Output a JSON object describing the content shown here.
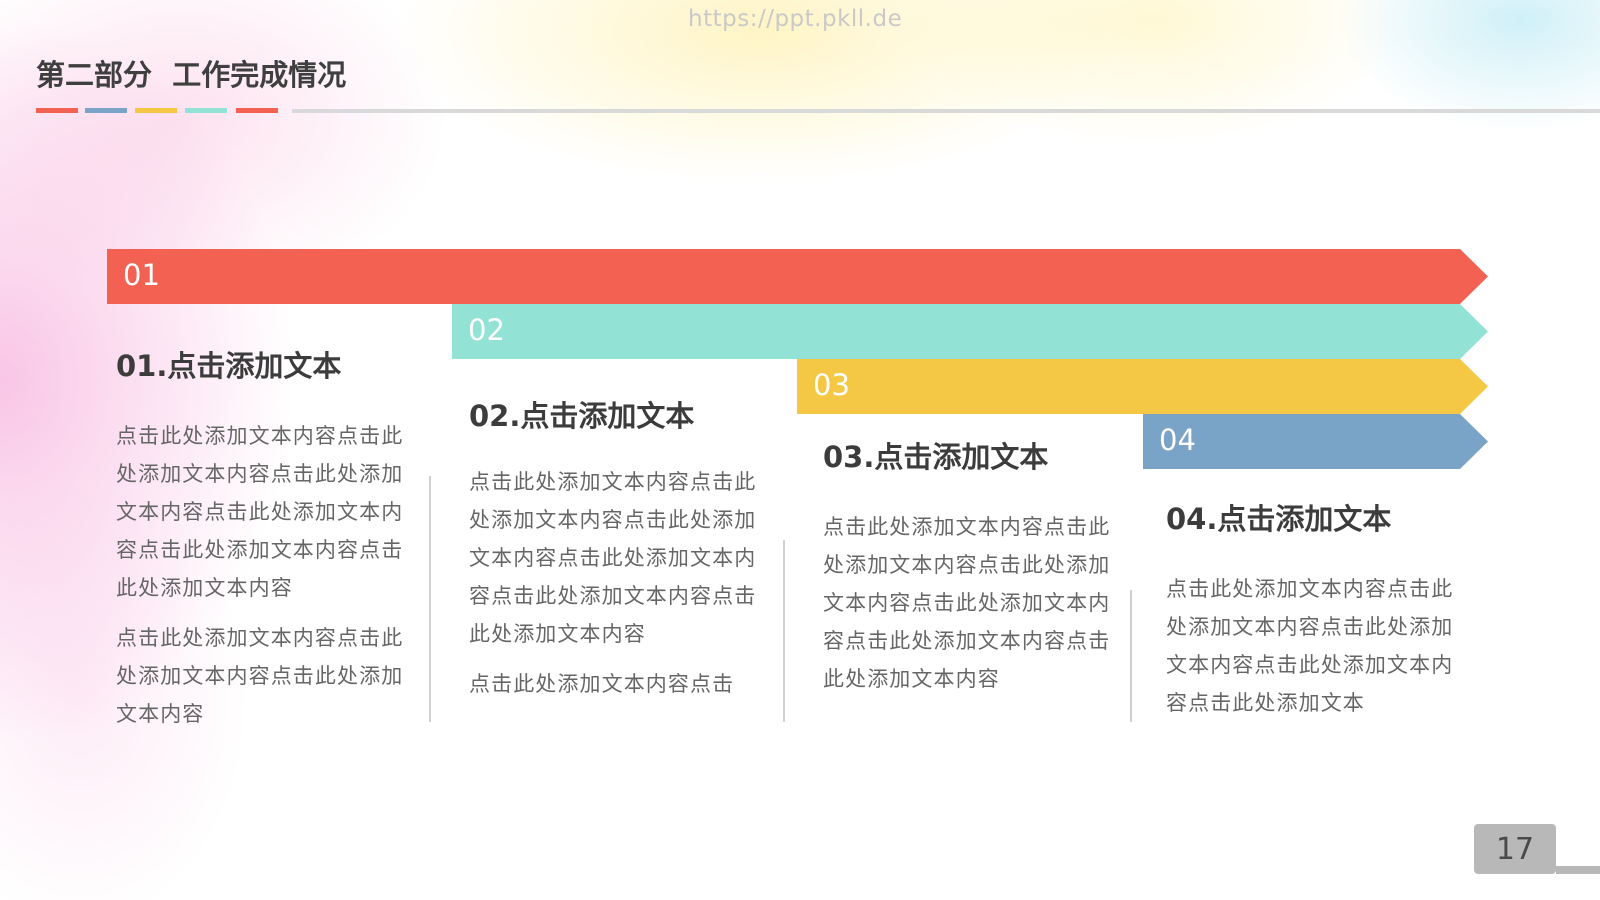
{
  "watermark": "https://ppt.pkll.de",
  "slide_title": "第二部分  工作完成情况",
  "colors": {
    "red": "#f26152",
    "teal": "#92e2d6",
    "yellow": "#f4c845",
    "blue": "#7aa3c8",
    "rule_gray": "#d9d9d9"
  },
  "title_rule_segments": [
    "#f26152",
    "#7aa3c8",
    "#f4c845",
    "#92e2d6",
    "#f26152"
  ],
  "arrows": [
    {
      "num": "01",
      "color": "#f26152"
    },
    {
      "num": "02",
      "color": "#92e2d6"
    },
    {
      "num": "03",
      "color": "#f4c845"
    },
    {
      "num": "04",
      "color": "#7aa3c8"
    }
  ],
  "columns": [
    {
      "heading": "01.点击添加文本",
      "paragraphs": [
        "点击此处添加文本内容点击此处添加文本内容点击此处添加文本内容点击此处添加文本内容点击此处添加文本内容点击此处添加文本内容",
        "点击此处添加文本内容点击此处添加文本内容点击此处添加文本内容"
      ]
    },
    {
      "heading": "02.点击添加文本",
      "paragraphs": [
        "点击此处添加文本内容点击此处添加文本内容点击此处添加文本内容点击此处添加文本内容点击此处添加文本内容点击此处添加文本内容",
        "点击此处添加文本内容点击"
      ]
    },
    {
      "heading": "03.点击添加文本",
      "paragraphs": [
        "点击此处添加文本内容点击此处添加文本内容点击此处添加文本内容点击此处添加文本内容点击此处添加文本内容点击此处添加文本内容"
      ]
    },
    {
      "heading": "04.点击添加文本",
      "paragraphs": [
        "点击此处添加文本内容点击此处添加文本内容点击此处添加文本内容点击此处添加文本内容点击此处添加文本"
      ]
    }
  ],
  "page_number": "17"
}
